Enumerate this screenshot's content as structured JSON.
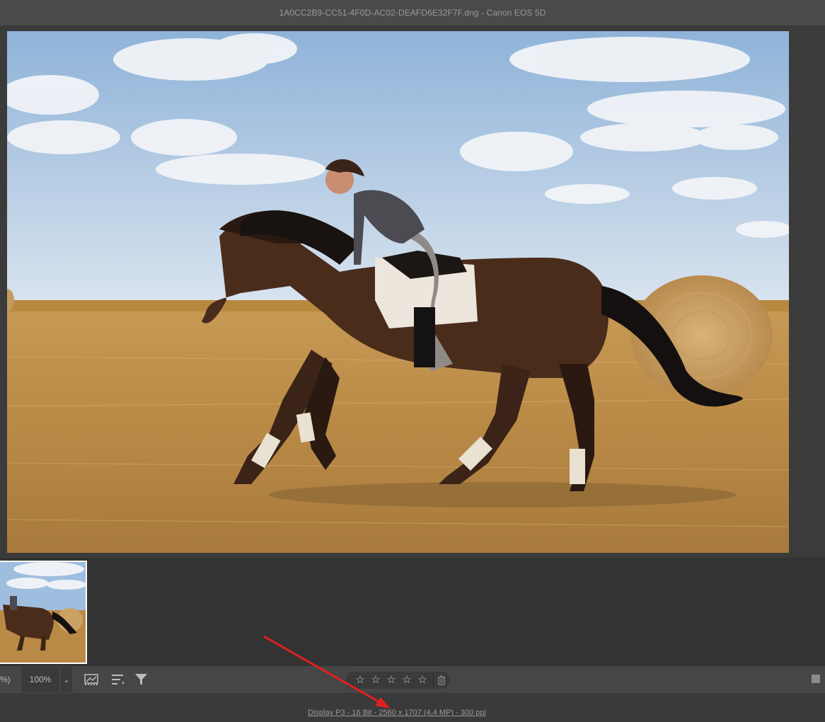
{
  "window": {
    "title": "1A0CC2B9-CC51-4F0D-AC02-DEAFD6E32F7F.dng  -  Canon EOS 5D"
  },
  "toolbar": {
    "zoom_prefix": "%)",
    "zoom_value": "100%",
    "zoom_dropdown_icon": "chevron-down-icon",
    "icons": [
      "workflow-options-icon",
      "sort-icon",
      "filter-icon",
      "delete-icon"
    ],
    "stars": [
      "☆",
      "☆",
      "☆",
      "☆",
      "☆"
    ]
  },
  "status": {
    "info": "Display P3 - 16 Bit - 2560 x 1707 (4,4 MP) - 300 ppi"
  },
  "colors": {
    "annotation_arrow": "#e02020",
    "thumbnail_border": "#ffffff"
  }
}
